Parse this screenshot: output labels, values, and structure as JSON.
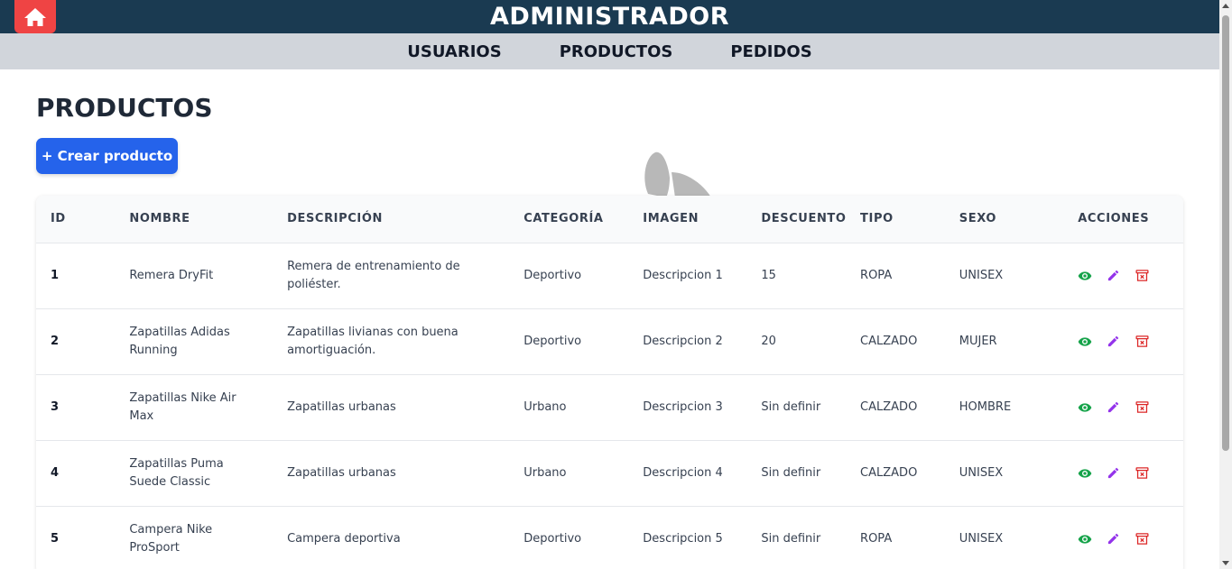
{
  "header": {
    "title": "ADMINISTRADOR",
    "home_icon": "home-icon",
    "home_color": "#ef4444",
    "bar_color": "#1a3a51"
  },
  "nav": {
    "items": [
      {
        "label": "USUARIOS"
      },
      {
        "label": "PRODUCTOS"
      },
      {
        "label": "PEDIDOS"
      }
    ]
  },
  "main": {
    "title": "PRODUCTOS",
    "create_button": "+ Crear producto"
  },
  "table": {
    "columns": [
      "ID",
      "NOMBRE",
      "DESCRIPCIÓN",
      "CATEGORÍA",
      "IMAGEN",
      "DESCUENTO",
      "TIPO",
      "SEXO",
      "ACCIONES"
    ],
    "rows": [
      {
        "id": "1",
        "nombre": "Remera DryFit",
        "descripcion": "Remera de entrenamiento de poliéster.",
        "categoria": "Deportivo",
        "imagen": "Descripcion 1",
        "descuento": "15",
        "tipo": "ROPA",
        "sexo": "UNISEX"
      },
      {
        "id": "2",
        "nombre": "Zapatillas Adidas Running",
        "descripcion": "Zapatillas livianas con buena amortiguación.",
        "categoria": "Deportivo",
        "imagen": "Descripcion 2",
        "descuento": "20",
        "tipo": "CALZADO",
        "sexo": "MUJER"
      },
      {
        "id": "3",
        "nombre": "Zapatillas Nike Air Max",
        "descripcion": "Zapatillas urbanas",
        "categoria": "Urbano",
        "imagen": "Descripcion 3",
        "descuento": "Sin definir",
        "tipo": "CALZADO",
        "sexo": "HOMBRE"
      },
      {
        "id": "4",
        "nombre": "Zapatillas Puma Suede Classic",
        "descripcion": "Zapatillas urbanas",
        "categoria": "Urbano",
        "imagen": "Descripcion 4",
        "descuento": "Sin definir",
        "tipo": "CALZADO",
        "sexo": "UNISEX"
      },
      {
        "id": "5",
        "nombre": "Campera Nike ProSport",
        "descripcion": "Campera deportiva",
        "categoria": "Deportivo",
        "imagen": "Descripcion 5",
        "descuento": "Sin definir",
        "tipo": "ROPA",
        "sexo": "UNISEX"
      }
    ],
    "actions": {
      "view_icon": "eye-icon",
      "edit_icon": "pencil-icon",
      "delete_icon": "trash-icon",
      "view_color": "#16a34a",
      "edit_color": "#9333ea",
      "delete_color": "#dc2626"
    }
  }
}
